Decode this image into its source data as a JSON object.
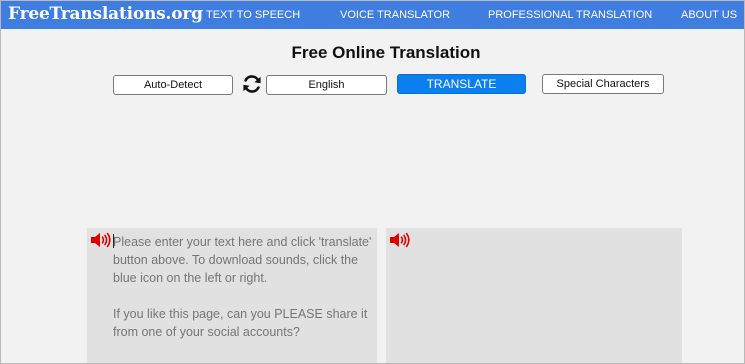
{
  "header": {
    "logo": "FreeTranslations.org",
    "nav": [
      "TEXT TO SPEECH",
      "VOICE TRANSLATOR",
      "PROFESSIONAL TRANSLATION",
      "ABOUT US"
    ]
  },
  "main": {
    "title": "Free Online Translation",
    "source_language": "Auto-Detect",
    "target_language": "English",
    "translate_label": "TRANSLATE",
    "special_chars_label": "Special Characters"
  },
  "source": {
    "placeholder": "Please enter your text here and click 'translate' button above. To download sounds, click the blue icon on the left or right.\n\nIf you like this page, can you PLEASE share it from one of your social accounts?",
    "value": ""
  },
  "colors": {
    "navbar": "#3f7de0",
    "translate_button": "#0a7ff0",
    "speaker_icon": "#e00000",
    "background": "#f2f2f2",
    "panel": "#e1e1e1"
  },
  "icons": {
    "swap": "refresh-arrows-icon",
    "speaker": "speaker-icon"
  }
}
